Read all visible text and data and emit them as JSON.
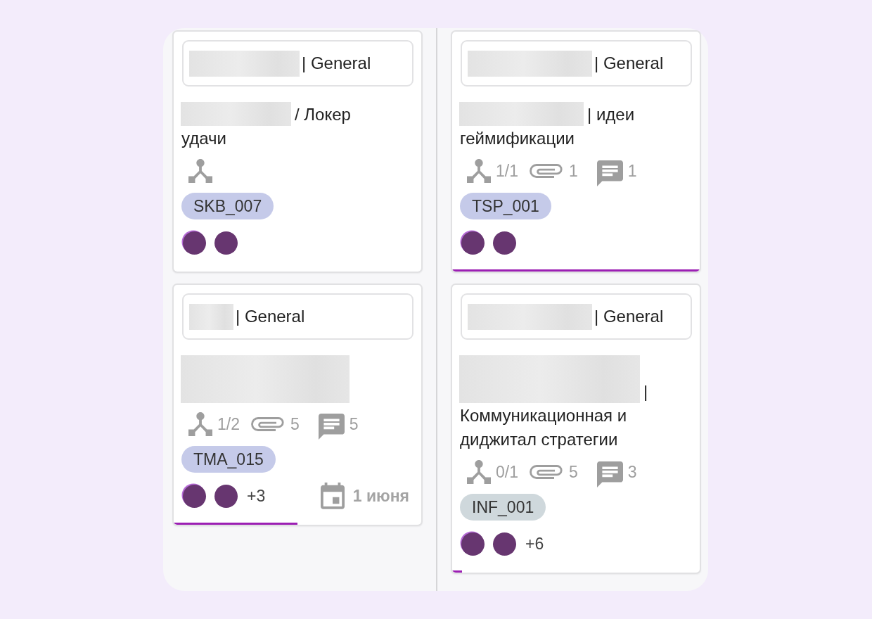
{
  "columns": [
    {
      "cards": [
        {
          "project": {
            "kind": "blurred-medium",
            "text": "| General"
          },
          "title": {
            "kind": "blurred-medium",
            "text": "/ Локер удачи"
          },
          "meta": [
            {
              "kind": "subtasks"
            }
          ],
          "tag": {
            "label": "SKB_007",
            "color": "#c5cae9"
          },
          "avatars": [
            {
              "kind": "photo"
            },
            {
              "kind": "photo"
            }
          ]
        },
        {
          "project": {
            "kind": "blurred-short",
            "text": "| General"
          },
          "title": {
            "kind": "blurred-block"
          },
          "meta": [
            {
              "kind": "subtasks",
              "count": "1/2"
            },
            {
              "kind": "attachments",
              "count": "5"
            },
            {
              "kind": "comments",
              "count": "5"
            }
          ],
          "tag": {
            "label": "TMA_015",
            "color": "#c5cae9"
          },
          "avatars": [
            {
              "kind": "photo"
            },
            {
              "kind": "photo"
            }
          ],
          "more_assignees": "+3",
          "due_date": "1 июня",
          "progress": {
            "level": 0.5
          }
        }
      ]
    },
    {
      "cards": [
        {
          "project": {
            "kind": "blurred-long",
            "text": "| General"
          },
          "title": {
            "kind": "blurred-long",
            "text": "| идеи геймификации"
          },
          "meta": [
            {
              "kind": "subtasks",
              "count": "1/1"
            },
            {
              "kind": "attachments",
              "count": "1"
            },
            {
              "kind": "comments",
              "count": "1"
            }
          ],
          "tag": {
            "label": "TSP_001",
            "color": "#c5cae9"
          },
          "avatars": [
            {
              "kind": "photo"
            },
            {
              "kind": "photo"
            }
          ],
          "progress": {
            "level": 1
          }
        },
        {
          "project": {
            "kind": "blurred-long",
            "text": "| General"
          },
          "title": {
            "kind": "blurred-wide-block",
            "text": "| Коммуникационная и диджитал стратегии"
          },
          "meta": [
            {
              "kind": "subtasks",
              "count": "0/1"
            },
            {
              "kind": "attachments",
              "count": "5"
            },
            {
              "kind": "comments",
              "count": "3"
            }
          ],
          "tag": {
            "label": "INF_001",
            "color": "#cfd8dc"
          },
          "avatars": [
            {
              "kind": "photo"
            },
            {
              "kind": "photo"
            }
          ],
          "more_assignees": "+6",
          "progress": {
            "level": 0.04
          }
        }
      ]
    }
  ]
}
